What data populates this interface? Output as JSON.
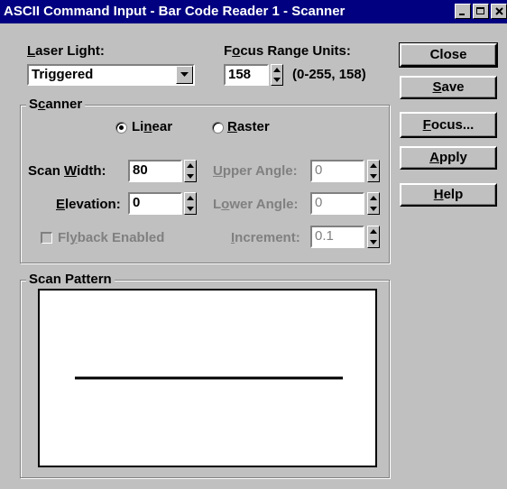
{
  "window": {
    "title": "ASCII Command Input - Bar Code Reader 1 - Scanner",
    "controls": [
      "minimize-icon",
      "maximize-icon",
      "close-icon"
    ]
  },
  "laser_light": {
    "label_pre": "",
    "label_ul": "L",
    "label_post": "aser Light:",
    "value": "Triggered"
  },
  "focus_range": {
    "label_pre": "F",
    "label_ul": "o",
    "label_post": "cus Range Units:",
    "value": "158",
    "range_hint": "(0-255, 158)"
  },
  "scanner": {
    "group_pre": "S",
    "group_ul": "c",
    "group_post": "anner",
    "mode_linear_pre": "Li",
    "mode_linear_ul": "n",
    "mode_linear_post": "ear",
    "mode_raster_pre": "",
    "mode_raster_ul": "R",
    "mode_raster_post": "aster",
    "selected_mode": "Linear",
    "scan_width_pre": "Scan ",
    "scan_width_ul": "W",
    "scan_width_post": "idth:",
    "scan_width_value": "80",
    "elevation_pre": "",
    "elevation_ul": "E",
    "elevation_post": "levation:",
    "elevation_value": "0",
    "flyback_pre": "Fl",
    "flyback_ul": "y",
    "flyback_post": "back Enabled",
    "upper_angle_pre": "",
    "upper_angle_ul": "U",
    "upper_angle_post": "pper Angle:",
    "upper_angle_value": "0",
    "lower_angle_pre": "L",
    "lower_angle_ul": "o",
    "lower_angle_post": "wer Angle:",
    "lower_angle_value": "0",
    "increment_pre": "",
    "increment_ul": "I",
    "increment_post": "ncrement:",
    "increment_value": "0.1"
  },
  "scan_pattern": {
    "group_label": "Scan Pattern"
  },
  "buttons": {
    "close": "Close",
    "save_pre": "",
    "save_ul": "S",
    "save_post": "ave",
    "focus_pre": "",
    "focus_ul": "F",
    "focus_post": "ocus...",
    "apply_pre": "",
    "apply_ul": "A",
    "apply_post": "pply",
    "help_pre": "",
    "help_ul": "H",
    "help_post": "elp"
  },
  "colors": {
    "title_bar": "#000080",
    "face": "#c0c0c0",
    "disabled_text": "#808080"
  }
}
